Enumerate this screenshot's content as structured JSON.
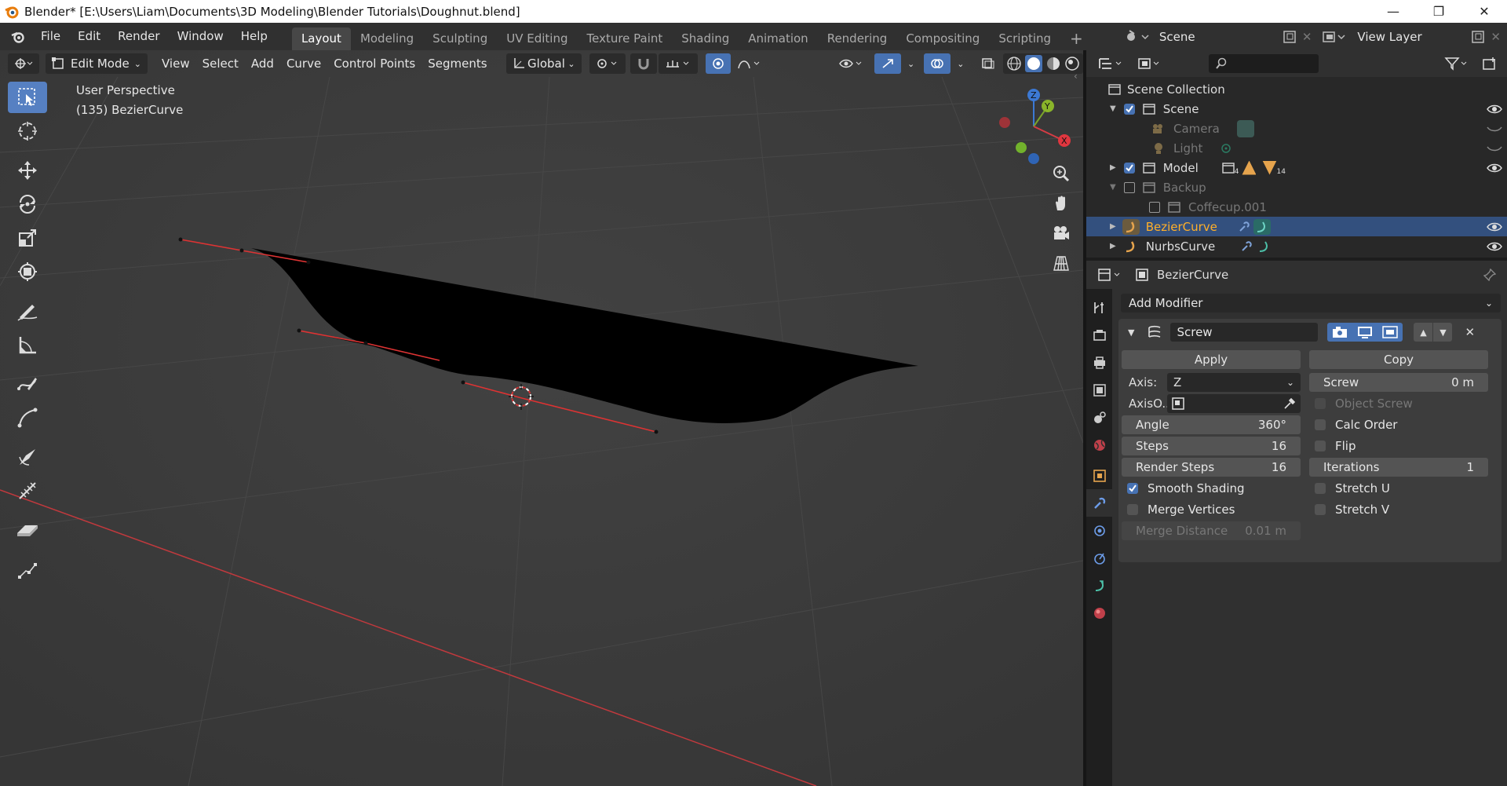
{
  "window": {
    "title": "Blender* [E:\\Users\\Liam\\Documents\\3D Modeling\\Blender Tutorials\\Doughnut.blend]",
    "minimize": "—",
    "maximize": "❐",
    "close": "✕"
  },
  "menu": [
    "File",
    "Edit",
    "Render",
    "Window",
    "Help"
  ],
  "workspaces": [
    "Layout",
    "Modeling",
    "Sculpting",
    "UV Editing",
    "Texture Paint",
    "Shading",
    "Animation",
    "Rendering",
    "Compositing",
    "Scripting"
  ],
  "active_workspace": "Layout",
  "add_workspace": "+",
  "scene": {
    "name": "Scene"
  },
  "view_layer": {
    "name": "View Layer"
  },
  "viewport_header": {
    "mode": "Edit Mode",
    "menus": [
      "View",
      "Select",
      "Add",
      "Curve",
      "Control Points",
      "Segments"
    ],
    "orientation": "Global"
  },
  "viewport": {
    "perspective": "User Perspective",
    "object_info": "(135) BezierCurve"
  },
  "gizmo": {
    "z": "Z",
    "y": "Y",
    "x": "X"
  },
  "outliner": {
    "collection": "Scene Collection",
    "rows": [
      {
        "label": "Scene",
        "dim": false,
        "badge": ""
      },
      {
        "label": "Camera",
        "dim": true,
        "badge": ""
      },
      {
        "label": "Light",
        "dim": true,
        "badge": ""
      },
      {
        "label": "Model",
        "dim": false,
        "badge": "4",
        "badge2": "14"
      },
      {
        "label": "Backup",
        "dim": true,
        "badge": ""
      },
      {
        "label": "Coffecup.001",
        "dim": true,
        "badge": ""
      },
      {
        "label": "BezierCurve",
        "dim": false,
        "badge": ""
      },
      {
        "label": "NurbsCurve",
        "dim": false,
        "badge": ""
      }
    ]
  },
  "properties": {
    "object_name": "BezierCurve",
    "add_modifier": "Add Modifier",
    "modifier": {
      "name": "Screw",
      "apply": "Apply",
      "copy": "Copy",
      "axis_label": "Axis:",
      "axis_value": "Z",
      "axis_object_label": "AxisO..",
      "screw_label": "Screw",
      "screw_value": "0 m",
      "object_screw": "Object Screw",
      "angle_label": "Angle",
      "angle_value": "360°",
      "steps_label": "Steps",
      "steps_value": "16",
      "render_steps_label": "Render Steps",
      "render_steps_value": "16",
      "calc_order": "Calc Order",
      "flip": "Flip",
      "iterations_label": "Iterations",
      "iterations_value": "1",
      "smooth_shading": "Smooth Shading",
      "merge_vertices": "Merge Vertices",
      "merge_distance_label": "Merge Distance",
      "merge_distance_value": "0.01 m",
      "stretch_u": "Stretch U",
      "stretch_v": "Stretch V",
      "smooth_shading_checked": true
    }
  },
  "colors": {
    "accent": "#4772b3",
    "selected_row": "#33507e",
    "object_orange": "#e6a44d",
    "axis_red": "#c1393d"
  }
}
